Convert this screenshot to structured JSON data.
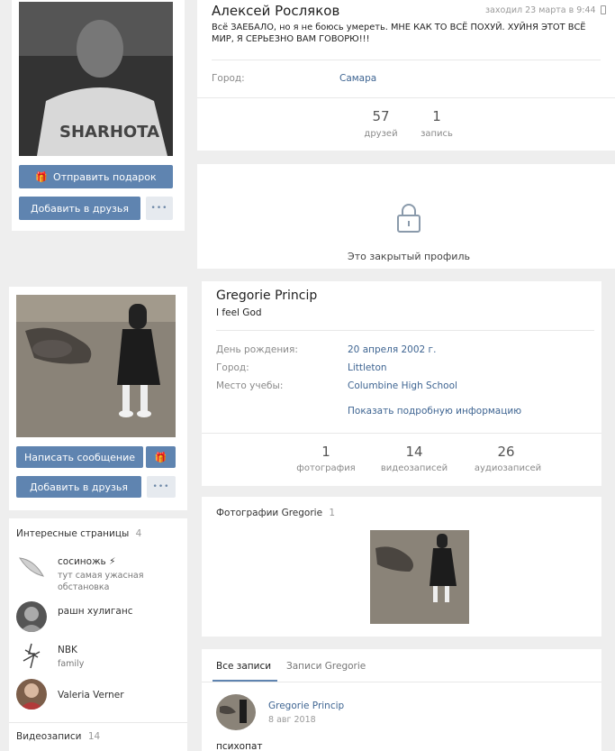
{
  "profile1": {
    "name": "Алексей Росляков",
    "last_seen": "заходил 23 марта в 9:44",
    "status": "Всё ЗАЕБАЛО, но я не боюсь умереть. МНЕ КАК ТО ВСЁ ПОХУЙ. ХУЙНЯ ЭТОТ ВСЁ МИР, Я СЕРЬЕЗНО ВАМ ГОВОРЮ!!!",
    "city_label": "Город:",
    "city_value": "Самара",
    "counters": [
      {
        "num": "57",
        "label": "друзей"
      },
      {
        "num": "1",
        "label": "запись"
      }
    ],
    "send_gift_label": "Отправить подарок",
    "add_friend_label": "Добавить в друзья",
    "more_label": "•••",
    "closed_profile_text": "Это закрытый профиль"
  },
  "profile2": {
    "name": "Gregorie Princip",
    "status": "I feel God",
    "info": [
      {
        "label": "День рождения:",
        "value": "20 апреля 2002 г."
      },
      {
        "label": "Город:",
        "value": "Littleton"
      },
      {
        "label": "Место учебы:",
        "value": "Columbine High School"
      }
    ],
    "show_more": "Показать подробную информацию",
    "counters": [
      {
        "num": "1",
        "label": "фотография"
      },
      {
        "num": "14",
        "label": "видеозаписей"
      },
      {
        "num": "26",
        "label": "аудиозаписей"
      }
    ],
    "message_label": "Написать сообщение",
    "add_friend_label": "Добавить в друзья",
    "more_label": "•••",
    "photos_title": "Фотографии Gregorie",
    "photos_count": "1",
    "interesting_title": "Интересные страницы",
    "interesting_count": "4",
    "interesting_pages": [
      {
        "name": "сосиножь ⚡",
        "sub": "тут самая ужасная обстановка"
      },
      {
        "name": "рашн хулиганс",
        "sub": ""
      },
      {
        "name": "NBK",
        "sub": "family"
      },
      {
        "name": "Valeria Verner",
        "sub": ""
      }
    ],
    "videos_title": "Видеозаписи",
    "videos_count": "14",
    "wall_tabs": [
      "Все записи",
      "Записи Gregorie"
    ],
    "post": {
      "author": "Gregorie Princip",
      "date": "8 авг 2018",
      "text": "психопат"
    }
  },
  "colors": {
    "accent": "#5f84b0",
    "link": "#3f6592",
    "background": "#eeeeee"
  }
}
